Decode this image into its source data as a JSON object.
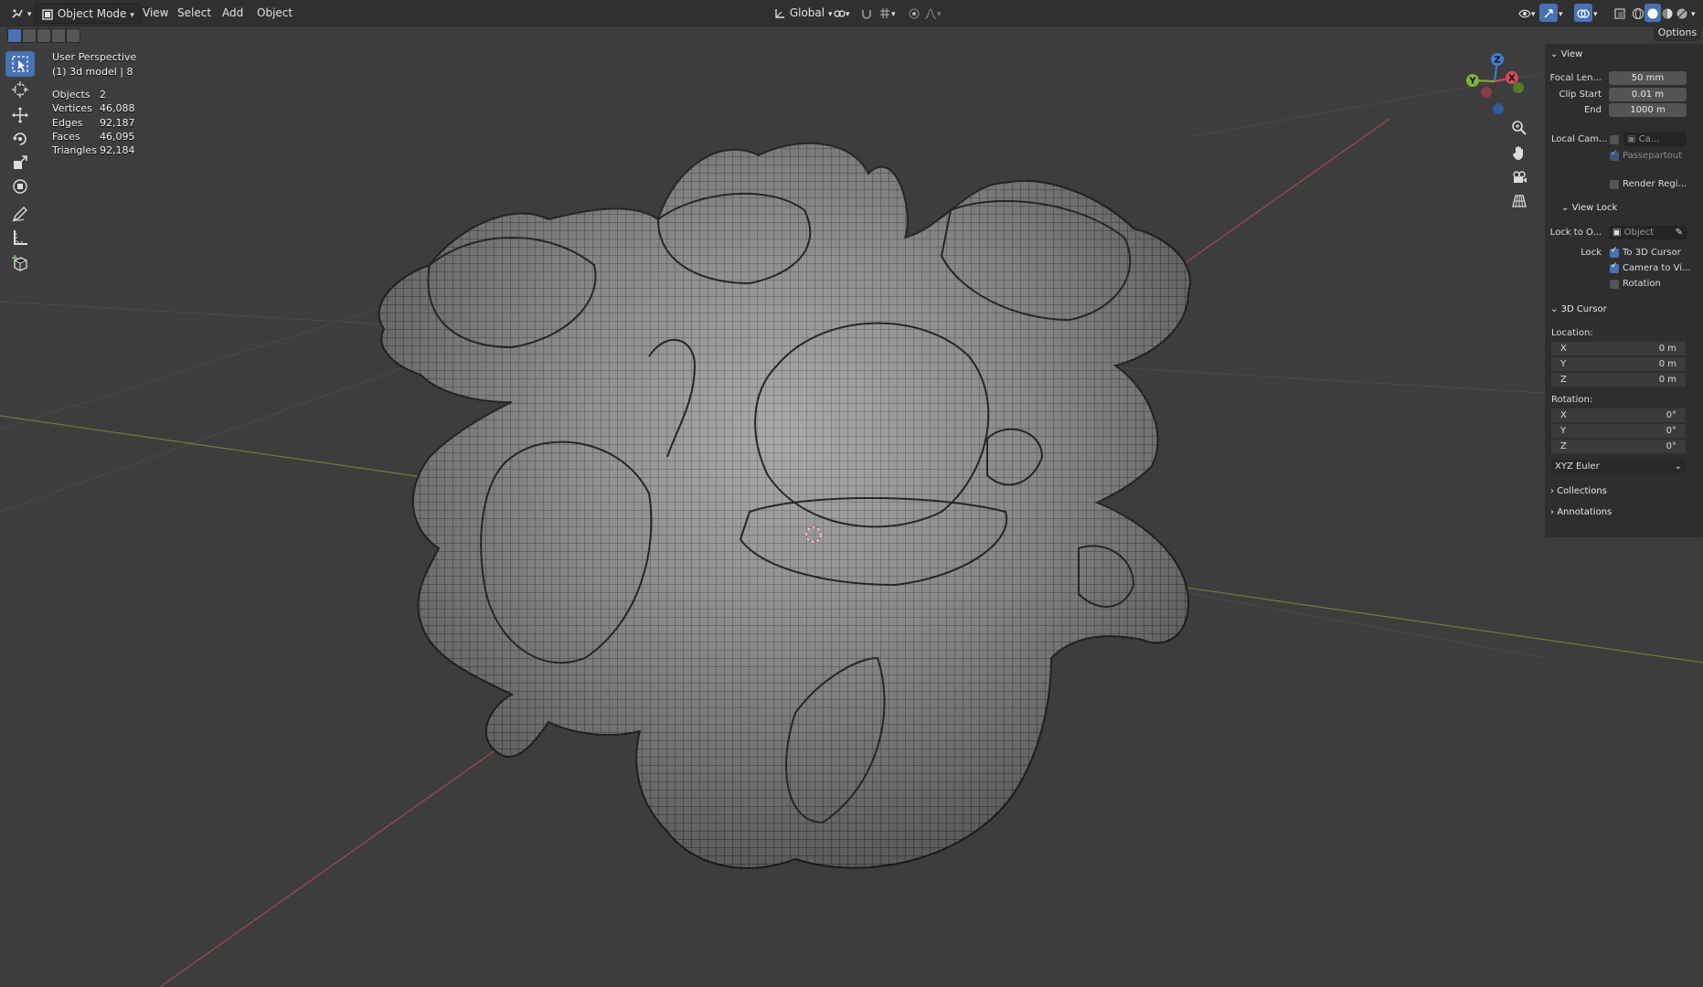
{
  "header": {
    "mode": "Object Mode",
    "menus": [
      "View",
      "Select",
      "Add",
      "Object"
    ],
    "transform_orientation": "Global"
  },
  "overlay": {
    "view_name": "User Perspective",
    "object_info": "(1) 3d model | 8",
    "stats": [
      {
        "label": "Objects",
        "value": "2"
      },
      {
        "label": "Vertices",
        "value": "46,088"
      },
      {
        "label": "Edges",
        "value": "92,187"
      },
      {
        "label": "Faces",
        "value": "46,095"
      },
      {
        "label": "Triangles",
        "value": "92,184"
      }
    ]
  },
  "options_label": "Options",
  "panel": {
    "view": {
      "title": "View",
      "focal_label": "Focal Len...",
      "focal_value": "50 mm",
      "clip_start_label": "Clip Start",
      "clip_start_value": "0.01 m",
      "end_label": "End",
      "end_value": "1000 m",
      "local_cam_label": "Local Cam...",
      "local_cam_value": "Ca...",
      "passepartout_label": "Passepartout",
      "render_region_label": "Render Regi..."
    },
    "view_lock": {
      "title": "View Lock",
      "lock_to_label": "Lock to O...",
      "lock_to_placeholder": "Object",
      "lock_label": "Lock",
      "to_cursor_label": "To 3D Cursor",
      "to_cursor_checked": true,
      "camera_to_view_label": "Camera to Vi...",
      "camera_to_view_checked": true,
      "rotation_label": "Rotation",
      "rotation_checked": false
    },
    "cursor": {
      "title": "3D Cursor",
      "location_label": "Location:",
      "location": [
        {
          "axis": "X",
          "value": "0 m"
        },
        {
          "axis": "Y",
          "value": "0 m"
        },
        {
          "axis": "Z",
          "value": "0 m"
        }
      ],
      "rotation_label": "Rotation:",
      "rotation": [
        {
          "axis": "X",
          "value": "0°"
        },
        {
          "axis": "Y",
          "value": "0°"
        },
        {
          "axis": "Z",
          "value": "0°"
        }
      ],
      "rotation_mode": "XYZ Euler"
    },
    "collections_title": "Collections",
    "annotations_title": "Annotations"
  },
  "gizmo": {
    "x": "X",
    "y": "Y",
    "z": "Z"
  },
  "colors": {
    "accent": "#4772b3",
    "x_axis": "#d44a5a",
    "y_axis": "#7fb33a",
    "z_axis": "#3f7fd1"
  }
}
